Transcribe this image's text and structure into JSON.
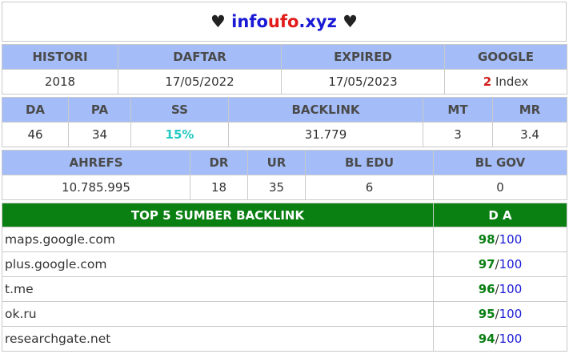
{
  "title": {
    "heart_left": "♥",
    "domain_part1": "info",
    "domain_part2": "ufo",
    "domain_part3": ".xyz",
    "heart_right": "♥"
  },
  "table1": {
    "headers": [
      "HISTORI",
      "DAFTAR",
      "EXPIRED",
      "GOOGLE"
    ],
    "values": {
      "histori": "2018",
      "daftar": "17/05/2022",
      "expired": "17/05/2023",
      "google_count": "2",
      "google_label": "Index"
    }
  },
  "table2": {
    "headers": [
      "DA",
      "PA",
      "SS",
      "BACKLINK",
      "MT",
      "MR"
    ],
    "values": [
      "46",
      "34",
      "15%",
      "31.779",
      "3",
      "3.4"
    ]
  },
  "table3": {
    "headers": [
      "AHREFS",
      "DR",
      "UR",
      "BL EDU",
      "BL GOV"
    ],
    "values": [
      "10.785.995",
      "18",
      "35",
      "6",
      "0"
    ]
  },
  "backlinks": {
    "header_source": "TOP 5 SUMBER BACKLINK",
    "header_da": "D A",
    "rows": [
      {
        "site": "maps.google.com",
        "da": "98",
        "sep": "/",
        "max": "100"
      },
      {
        "site": "plus.google.com",
        "da": "97",
        "sep": "/",
        "max": "100"
      },
      {
        "site": "t.me",
        "da": "96",
        "sep": "/",
        "max": "100"
      },
      {
        "site": "ok.ru",
        "da": "95",
        "sep": "/",
        "max": "100"
      },
      {
        "site": "researchgate.net",
        "da": "94",
        "sep": "/",
        "max": "100"
      }
    ]
  },
  "colors": {
    "header_bg": "#a4bdf8",
    "green_header": "#0a7f12",
    "blue": "#1a1ad6",
    "red": "#e21b1b",
    "teal": "#25c9c4"
  }
}
